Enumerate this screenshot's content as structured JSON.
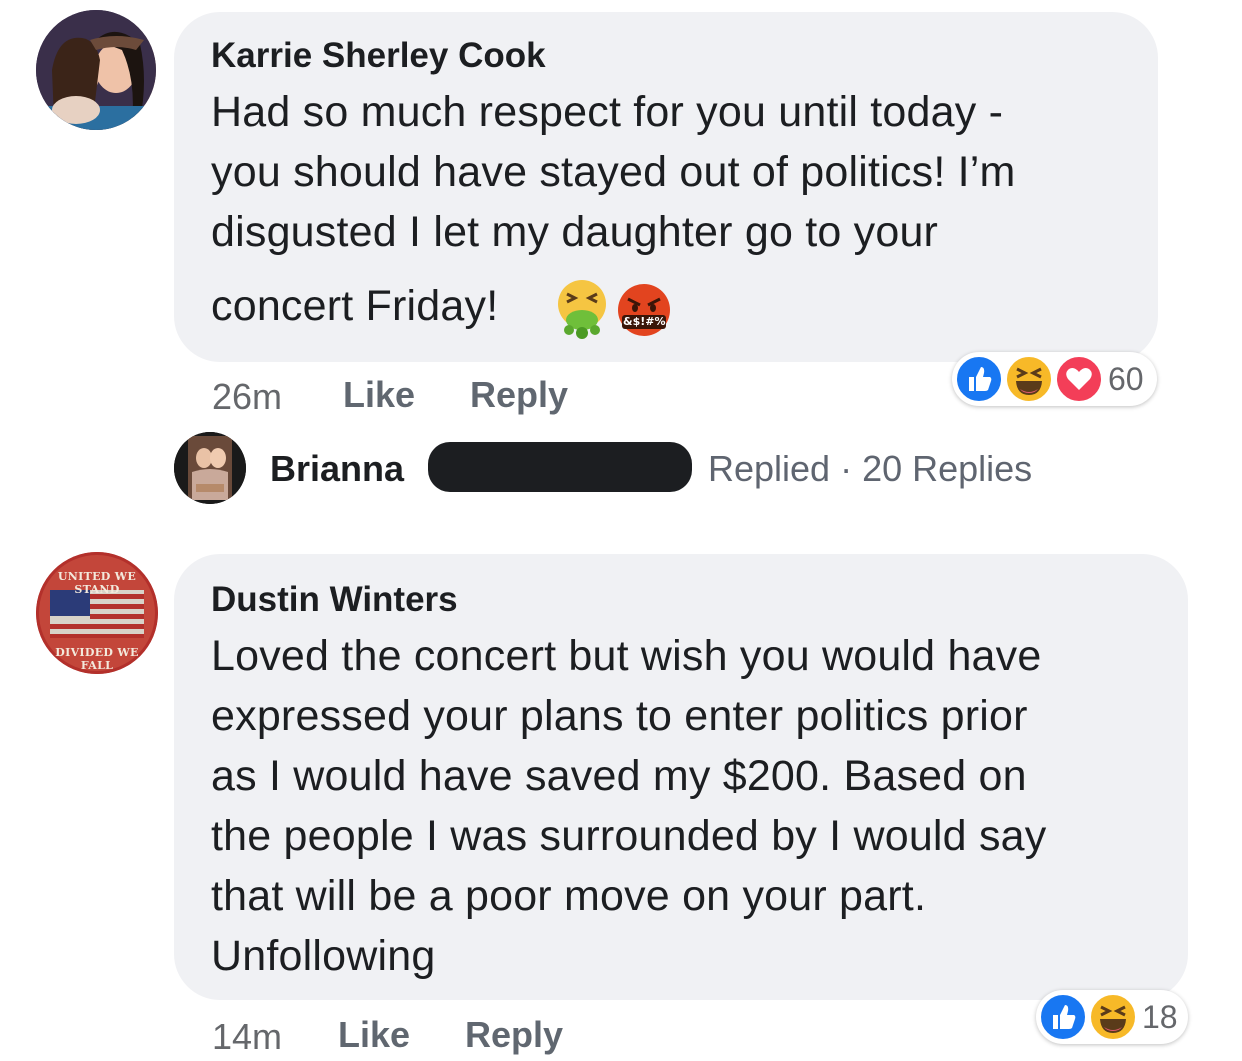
{
  "comments": [
    {
      "author": "Karrie Sherley Cook",
      "lines": [
        "Had so much respect for you until today -",
        "you should have stayed out of politics! I’m",
        "disgusted I let my daughter go to your",
        "concert Friday!"
      ],
      "emoji": [
        "nauseated-face",
        "face-with-symbols-on-mouth"
      ],
      "emoji_symbol_text": "&$!#%",
      "time": "26m",
      "like_label": "Like",
      "reply_label": "Reply",
      "reactions": [
        "like",
        "haha",
        "love"
      ],
      "reaction_count": "60",
      "reply_thread": {
        "name": "Brianna",
        "replied_text": "Replied · 20 Replies"
      }
    },
    {
      "author": "Dustin Winters",
      "avatar_text_top": "UNITED WE STAND",
      "avatar_text_bottom": "DIVIDED WE FALL",
      "lines": [
        "Loved the concert but wish you would have",
        "expressed your plans to enter politics prior",
        "as I would have saved my $200.  Based on",
        "the people I was surrounded by I would say",
        "that will be a poor move on your part.",
        "Unfollowing"
      ],
      "time": "14m",
      "like_label": "Like",
      "reply_label": "Reply",
      "reactions": [
        "like",
        "haha"
      ],
      "reaction_count": "18"
    }
  ],
  "colors": {
    "bubble": "#f0f1f4",
    "like_blue": "#1877f2",
    "love_red": "#f33e58",
    "haha_yellow": "#f7b928",
    "redaction": "#1c1e21"
  }
}
